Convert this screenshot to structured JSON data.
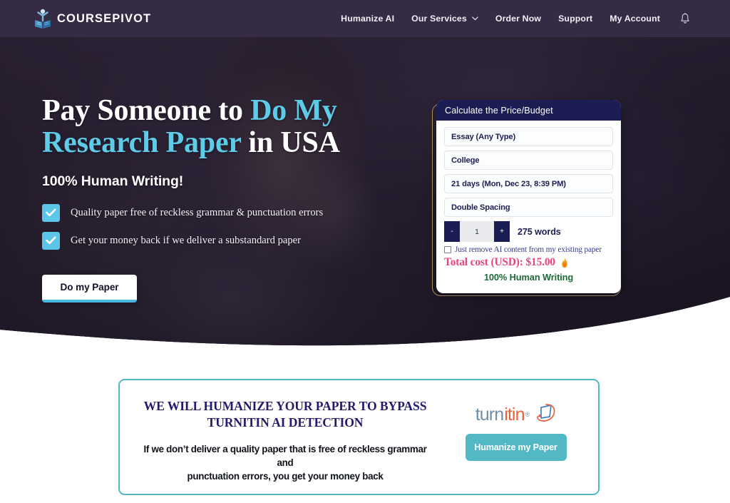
{
  "header": {
    "brand_name": "COURSEPIVOT",
    "logo_icon": "person-book-logo-icon",
    "nav": [
      {
        "label": "Humanize AI",
        "has_caret": false
      },
      {
        "label": "Our Services",
        "has_caret": true
      },
      {
        "label": "Order Now",
        "has_caret": false
      },
      {
        "label": "Support",
        "has_caret": false
      },
      {
        "label": "My Account",
        "has_caret": false
      }
    ],
    "bell_icon": "notification-bell-icon"
  },
  "hero": {
    "title_part1": "Pay Someone to ",
    "title_highlight1": "Do My",
    "title_highlight2": "Research Paper",
    "title_part2": " in USA",
    "subtitle": "100% Human Writing!",
    "bullets": [
      "Quality paper free of reckless grammar & punctuation errors",
      "Get your money back if we deliver a substandard paper"
    ],
    "cta_label": "Do my Paper",
    "accent_color": "#5ecbe8"
  },
  "calculator": {
    "heading": "Calculate the Price/Budget",
    "paper_type": "Essay (Any Type)",
    "academic_level": "College",
    "deadline": "21 days (Mon, Dec 23, 8:39 PM)",
    "spacing": "Double Spacing",
    "decrement_label": "-",
    "pages_value": "1",
    "increment_label": "+",
    "word_count": "275 words",
    "checkbox_label": "Just remove AI content from my existing paper",
    "checkbox_checked": false,
    "total_cost": "Total cost (USD): $15.00",
    "flame_icon": "flame-icon",
    "human_writing": "100% Human Writing",
    "header_color": "#1c1d52",
    "total_color": "#e8457f",
    "human_color": "#1d6b36"
  },
  "promo": {
    "title_line1": "WE WILL HUMANIZE YOUR PAPER TO BYPASS",
    "title_line2": "TURNITIN AI DETECTION",
    "body_line1": "If we don’t deliver a quality paper that is free of reckless grammar and",
    "body_line2": "punctuation errors, you get your money back",
    "logo_part1": "turn",
    "logo_part2": "itin",
    "logo_reg": "®",
    "logo_icon": "turnitin-swoosh-icon",
    "button_label": "Humanize my Paper",
    "accent_color": "#53b8c6"
  }
}
